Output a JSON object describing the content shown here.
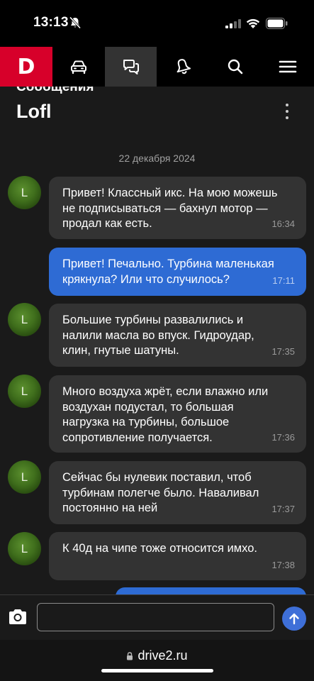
{
  "status": {
    "time": "13:13"
  },
  "nav": {
    "logo": "D",
    "items": [
      {
        "name": "garage",
        "icon": "car-icon"
      },
      {
        "name": "messages",
        "icon": "chat-icon",
        "active": true
      },
      {
        "name": "notifications",
        "icon": "bell-icon"
      },
      {
        "name": "search",
        "icon": "search-icon"
      },
      {
        "name": "menu",
        "icon": "menu-icon"
      }
    ]
  },
  "header": {
    "section": "Сообщения",
    "title": "Lofl"
  },
  "date_separator": "22 декабря 2024",
  "messages": [
    {
      "from": "them",
      "avatar": "L",
      "text": "Привет! Классный икс. На мою можешь\nне подписываться — бахнул мотор —\nпродал как есть.",
      "time": "16:34"
    },
    {
      "from": "me",
      "text": "Привет! Печально. Турбина маленькая\nкрякнула? Или что случилось?",
      "time": "17:11"
    },
    {
      "from": "them",
      "avatar": "L",
      "text": "Большие турбины развалились и\nналили масла во впуск. Гидроудар,\nклин, гнутые шатуны.",
      "time": "17:35"
    },
    {
      "from": "them",
      "avatar": "L",
      "text": "Много воздуха жрёт, если влажно или\nвоздухан подустал, то большая\nнагрузка на турбины, большое\nсопротивление получается.",
      "time": "17:36"
    },
    {
      "from": "them",
      "avatar": "L",
      "text": "Сейчас бы нулевик поставил, чтоб\nтурбинам полегче было. Наваливал\nпостоянно на ней",
      "time": "17:37"
    },
    {
      "from": "them",
      "avatar": "L",
      "text": "К 40д на чипе тоже относится имхо.",
      "time": "17:38"
    }
  ],
  "composer": {
    "value": "",
    "placeholder": ""
  },
  "browser": {
    "url": "drive2.ru"
  },
  "colors": {
    "brand": "#d7002a",
    "outgoing": "#2e6bd4",
    "incoming": "#333333",
    "background": "#1a1a1a"
  }
}
